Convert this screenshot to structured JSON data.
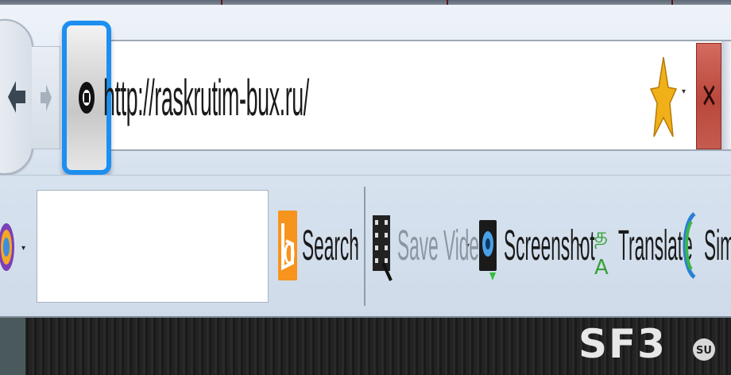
{
  "navigation": {
    "url": "http://raskrutim-bux.ru/"
  },
  "toolbar": {
    "search_label": "Search",
    "save_video_label": "Save Video",
    "screenshot_label": "Screenshot",
    "translate_label": "Translate",
    "similar_label": "Simi"
  },
  "watermark": {
    "text": "SF3",
    "badge": "SU"
  },
  "icons": {
    "back": "back-arrow-icon",
    "forward": "forward-arrow-icon",
    "site_identity": "globe-icon",
    "bookmark": "star-icon",
    "stop": "stop-icon",
    "addon": "addon-icon",
    "search_engine": "bing-icon",
    "save_video": "film-icon",
    "screenshot": "camera-icon",
    "translate": "translate-icon",
    "similar": "similar-sites-icon"
  },
  "colors": {
    "site_identity_border": "#1c8ff0",
    "stop_button": "#c65b50",
    "bookmark_star": "#f0b018",
    "bing_orange": "#f7941d",
    "translate_green": "#35a035"
  }
}
